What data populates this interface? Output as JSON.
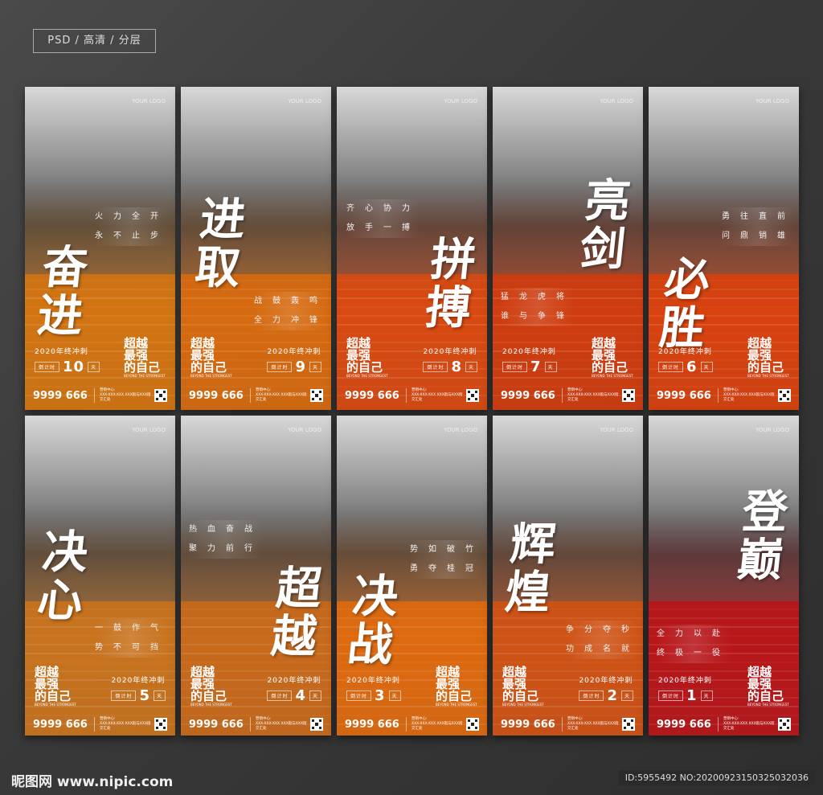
{
  "header": {
    "tag": "PSD / 高清 / 分层"
  },
  "common": {
    "your_logo": "YOUR LOGO",
    "campaign": "2020年终冲刺",
    "countdown_label": "倒计时",
    "day_unit": "天",
    "logo_text": [
      "超越",
      "最强",
      "的自己"
    ],
    "logo_sub": "BEYOND THE STRONGEST",
    "phone": "9999 666",
    "addr_label": "营销中心:",
    "addr": "XXX-XXX-XXX XXX街与XXX街交汇处"
  },
  "posters": [
    {
      "title": "奋进",
      "slogan": [
        "火力全开",
        "永不止步"
      ],
      "days": "10",
      "color": "#d27412"
    },
    {
      "title": "进取",
      "slogan": [
        "战鼓轰鸣",
        "全力冲锋"
      ],
      "days": "9",
      "color": "#d66a10"
    },
    {
      "title": "拼搏",
      "slogan": [
        "齐心协力",
        "放手一搏"
      ],
      "days": "8",
      "color": "#d84a12"
    },
    {
      "title": "亮剑",
      "slogan": [
        "猛龙虎将",
        "谁与争锋"
      ],
      "days": "7",
      "color": "#cf3d10"
    },
    {
      "title": "必胜",
      "slogan": [
        "勇往直前",
        "问鼎销雄"
      ],
      "days": "6",
      "color": "#d8420f"
    },
    {
      "title": "决心",
      "slogan": [
        "一鼓作气",
        "势不可挡"
      ],
      "days": "5",
      "color": "#c8731e"
    },
    {
      "title": "超越",
      "slogan": [
        "热血奋战",
        "聚力前行"
      ],
      "days": "4",
      "color": "#c86a1c"
    },
    {
      "title": "决战",
      "slogan": [
        "势如破竹",
        "勇夺桂冠"
      ],
      "days": "3",
      "color": "#de6a10"
    },
    {
      "title": "辉煌",
      "slogan": [
        "争分夺秒",
        "功成名就"
      ],
      "days": "2",
      "color": "#cf5316"
    },
    {
      "title": "登巅",
      "slogan": [
        "全力以赴",
        "终极一役"
      ],
      "days": "1",
      "color": "#b8171a"
    }
  ],
  "footer": {
    "brand": "昵图网 www.nipic.com",
    "id": "ID:5955492 NO:20200923150325032036"
  }
}
